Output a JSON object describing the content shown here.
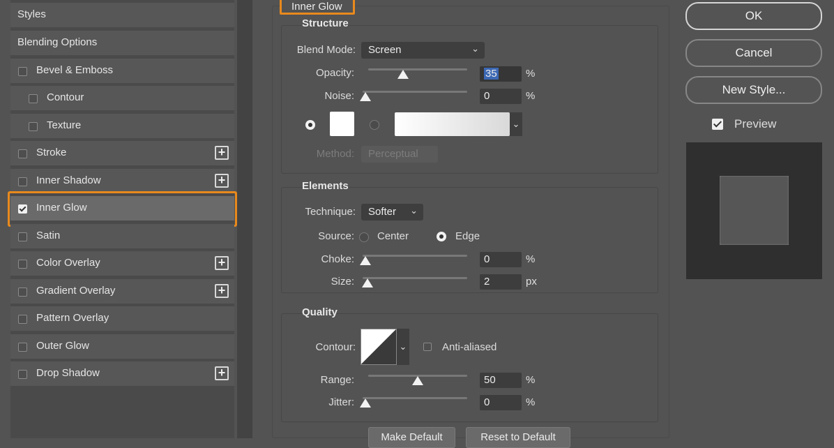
{
  "sidebar": {
    "items": [
      {
        "label": "Styles"
      },
      {
        "label": "Blending Options"
      },
      {
        "label": "Bevel & Emboss"
      },
      {
        "label": "Contour"
      },
      {
        "label": "Texture"
      },
      {
        "label": "Stroke"
      },
      {
        "label": "Inner Shadow"
      },
      {
        "label": "Inner Glow"
      },
      {
        "label": "Satin"
      },
      {
        "label": "Color Overlay"
      },
      {
        "label": "Gradient Overlay"
      },
      {
        "label": "Pattern Overlay"
      },
      {
        "label": "Outer Glow"
      },
      {
        "label": "Drop Shadow"
      }
    ],
    "plus_glyph": "+"
  },
  "panel": {
    "title": "Inner Glow",
    "structure": {
      "title": "Structure",
      "blend_mode_label": "Blend Mode:",
      "blend_mode_value": "Screen",
      "opacity_label": "Opacity:",
      "opacity_value": "35",
      "opacity_unit": "%",
      "opacity_fraction": 0.35,
      "noise_label": "Noise:",
      "noise_value": "0",
      "noise_unit": "%",
      "noise_fraction": 0,
      "method_label": "Method:",
      "method_value": "Perceptual"
    },
    "elements": {
      "title": "Elements",
      "technique_label": "Technique:",
      "technique_value": "Softer",
      "source_label": "Source:",
      "source_center": "Center",
      "source_edge": "Edge",
      "choke_label": "Choke:",
      "choke_value": "0",
      "choke_unit": "%",
      "choke_fraction": 0,
      "size_label": "Size:",
      "size_value": "2",
      "size_unit": "px",
      "size_fraction": 0.02
    },
    "quality": {
      "title": "Quality",
      "contour_label": "Contour:",
      "anti_aliased_label": "Anti-aliased",
      "range_label": "Range:",
      "range_value": "50",
      "range_unit": "%",
      "range_fraction": 0.5,
      "jitter_label": "Jitter:",
      "jitter_value": "0",
      "jitter_unit": "%",
      "jitter_fraction": 0
    },
    "buttons": {
      "make_default": "Make Default",
      "reset_default": "Reset to Default"
    }
  },
  "actions": {
    "ok": "OK",
    "cancel": "Cancel",
    "new_style": "New Style...",
    "preview_label": "Preview"
  },
  "colors": {
    "accent": "#e8891d",
    "background": "#535353",
    "glow_color": "#ffffff"
  }
}
